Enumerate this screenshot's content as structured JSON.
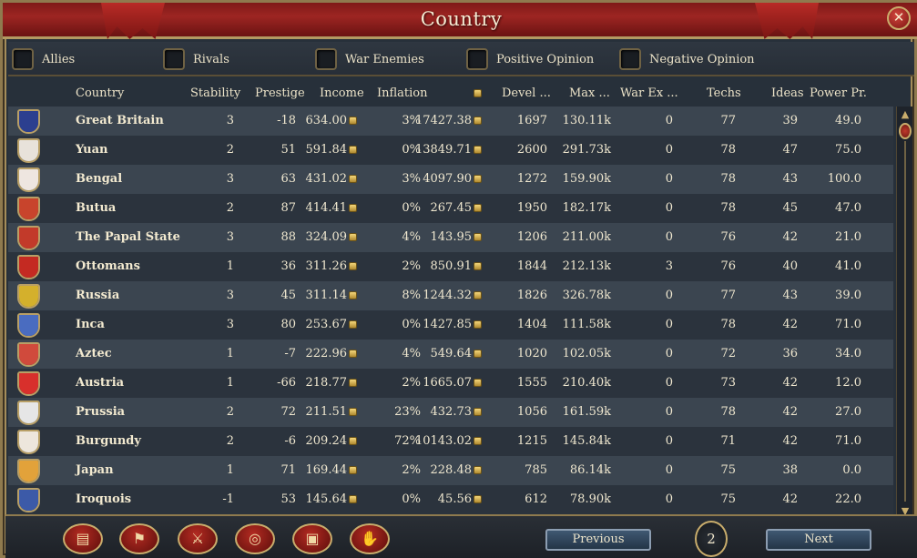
{
  "window": {
    "title": "Country"
  },
  "filters": [
    {
      "label": "Allies"
    },
    {
      "label": "Rivals"
    },
    {
      "label": "War Enemies"
    },
    {
      "label": "Positive Opinion"
    },
    {
      "label": "Negative Opinion"
    }
  ],
  "columns": {
    "country": "Country",
    "stability": "Stability",
    "prestige": "Prestige",
    "income": "Income",
    "inflation": "Inflation",
    "treasury": "",
    "devel": "Devel ...",
    "max": "Max ...",
    "warex": "War Ex ...",
    "techs": "Techs",
    "ideas": "Ideas",
    "power": "Power Pr."
  },
  "rows": [
    {
      "flag": "union-jack-flag",
      "flag_color": "#2c3f8f",
      "name": "Great Britain",
      "stability": "3",
      "prestige": "-18",
      "income": "634.00",
      "inflation": "3%",
      "treasury": "17427.38",
      "devel": "1697",
      "max": "130.11k",
      "warex": "0",
      "techs": "77",
      "ideas": "39",
      "power": "49.0"
    },
    {
      "flag": "yuan-flag",
      "flag_color": "#e8e2da",
      "name": "Yuan",
      "stability": "2",
      "prestige": "51",
      "income": "591.84",
      "inflation": "0%",
      "treasury": "13849.71",
      "devel": "2600",
      "max": "291.73k",
      "warex": "0",
      "techs": "78",
      "ideas": "47",
      "power": "75.0"
    },
    {
      "flag": "bengal-flag",
      "flag_color": "#eee6e0",
      "name": "Bengal",
      "stability": "3",
      "prestige": "63",
      "income": "431.02",
      "inflation": "3%",
      "treasury": "4097.90",
      "devel": "1272",
      "max": "159.90k",
      "warex": "0",
      "techs": "78",
      "ideas": "43",
      "power": "100.0"
    },
    {
      "flag": "butua-flag",
      "flag_color": "#c8442c",
      "name": "Butua",
      "stability": "2",
      "prestige": "87",
      "income": "414.41",
      "inflation": "0%",
      "treasury": "267.45",
      "devel": "1950",
      "max": "182.17k",
      "warex": "0",
      "techs": "78",
      "ideas": "45",
      "power": "47.0"
    },
    {
      "flag": "papal-state-flag",
      "flag_color": "#c23a2a",
      "name": "The Papal State",
      "stability": "3",
      "prestige": "88",
      "income": "324.09",
      "inflation": "4%",
      "treasury": "143.95",
      "devel": "1206",
      "max": "211.00k",
      "warex": "0",
      "techs": "76",
      "ideas": "42",
      "power": "21.0"
    },
    {
      "flag": "ottomans-flag",
      "flag_color": "#c42a22",
      "name": "Ottomans",
      "stability": "1",
      "prestige": "36",
      "income": "311.26",
      "inflation": "2%",
      "treasury": "850.91",
      "devel": "1844",
      "max": "212.13k",
      "warex": "3",
      "techs": "76",
      "ideas": "40",
      "power": "41.0"
    },
    {
      "flag": "russia-flag",
      "flag_color": "#d4b02c",
      "name": "Russia",
      "stability": "3",
      "prestige": "45",
      "income": "311.14",
      "inflation": "8%",
      "treasury": "1244.32",
      "devel": "1826",
      "max": "326.78k",
      "warex": "0",
      "techs": "77",
      "ideas": "43",
      "power": "39.0"
    },
    {
      "flag": "inca-flag",
      "flag_color": "#4a6cc0",
      "name": "Inca",
      "stability": "3",
      "prestige": "80",
      "income": "253.67",
      "inflation": "0%",
      "treasury": "1427.85",
      "devel": "1404",
      "max": "111.58k",
      "warex": "0",
      "techs": "78",
      "ideas": "42",
      "power": "71.0"
    },
    {
      "flag": "aztec-flag",
      "flag_color": "#d04a3c",
      "name": "Aztec",
      "stability": "1",
      "prestige": "-7",
      "income": "222.96",
      "inflation": "4%",
      "treasury": "549.64",
      "devel": "1020",
      "max": "102.05k",
      "warex": "0",
      "techs": "72",
      "ideas": "36",
      "power": "34.0"
    },
    {
      "flag": "austria-flag",
      "flag_color": "#d8302c",
      "name": "Austria",
      "stability": "1",
      "prestige": "-66",
      "income": "218.77",
      "inflation": "2%",
      "treasury": "1665.07",
      "devel": "1555",
      "max": "210.40k",
      "warex": "0",
      "techs": "73",
      "ideas": "42",
      "power": "12.0"
    },
    {
      "flag": "prussia-flag",
      "flag_color": "#e6e6e6",
      "name": "Prussia",
      "stability": "2",
      "prestige": "72",
      "income": "211.51",
      "inflation": "23%",
      "treasury": "432.73",
      "devel": "1056",
      "max": "161.59k",
      "warex": "0",
      "techs": "78",
      "ideas": "42",
      "power": "27.0"
    },
    {
      "flag": "burgundy-flag",
      "flag_color": "#ede6dc",
      "name": "Burgundy",
      "stability": "2",
      "prestige": "-6",
      "income": "209.24",
      "inflation": "72%",
      "treasury": "10143.02",
      "devel": "1215",
      "max": "145.84k",
      "warex": "0",
      "techs": "71",
      "ideas": "42",
      "power": "71.0"
    },
    {
      "flag": "japan-flag",
      "flag_color": "#e2a23a",
      "name": "Japan",
      "stability": "1",
      "prestige": "71",
      "income": "169.44",
      "inflation": "2%",
      "treasury": "228.48",
      "devel": "785",
      "max": "86.14k",
      "warex": "0",
      "techs": "75",
      "ideas": "38",
      "power": "0.0"
    },
    {
      "flag": "iroquois-flag",
      "flag_color": "#3c5aa8",
      "name": "Iroquois",
      "stability": "-1",
      "prestige": "53",
      "income": "145.64",
      "inflation": "0%",
      "treasury": "45.56",
      "devel": "612",
      "max": "78.90k",
      "warex": "0",
      "techs": "75",
      "ideas": "42",
      "power": "22.0"
    }
  ],
  "bottom": {
    "previous_label": "Previous",
    "next_label": "Next",
    "page": "2",
    "tools": [
      {
        "icon": "ledger-icon",
        "glyph": "▤"
      },
      {
        "icon": "flag-icon",
        "glyph": "⚑"
      },
      {
        "icon": "crossed-swords-icon",
        "glyph": "⚔"
      },
      {
        "icon": "coins-icon",
        "glyph": "◎"
      },
      {
        "icon": "trade-goods-icon",
        "glyph": "▣"
      },
      {
        "icon": "handshake-icon",
        "glyph": "✋"
      }
    ]
  }
}
